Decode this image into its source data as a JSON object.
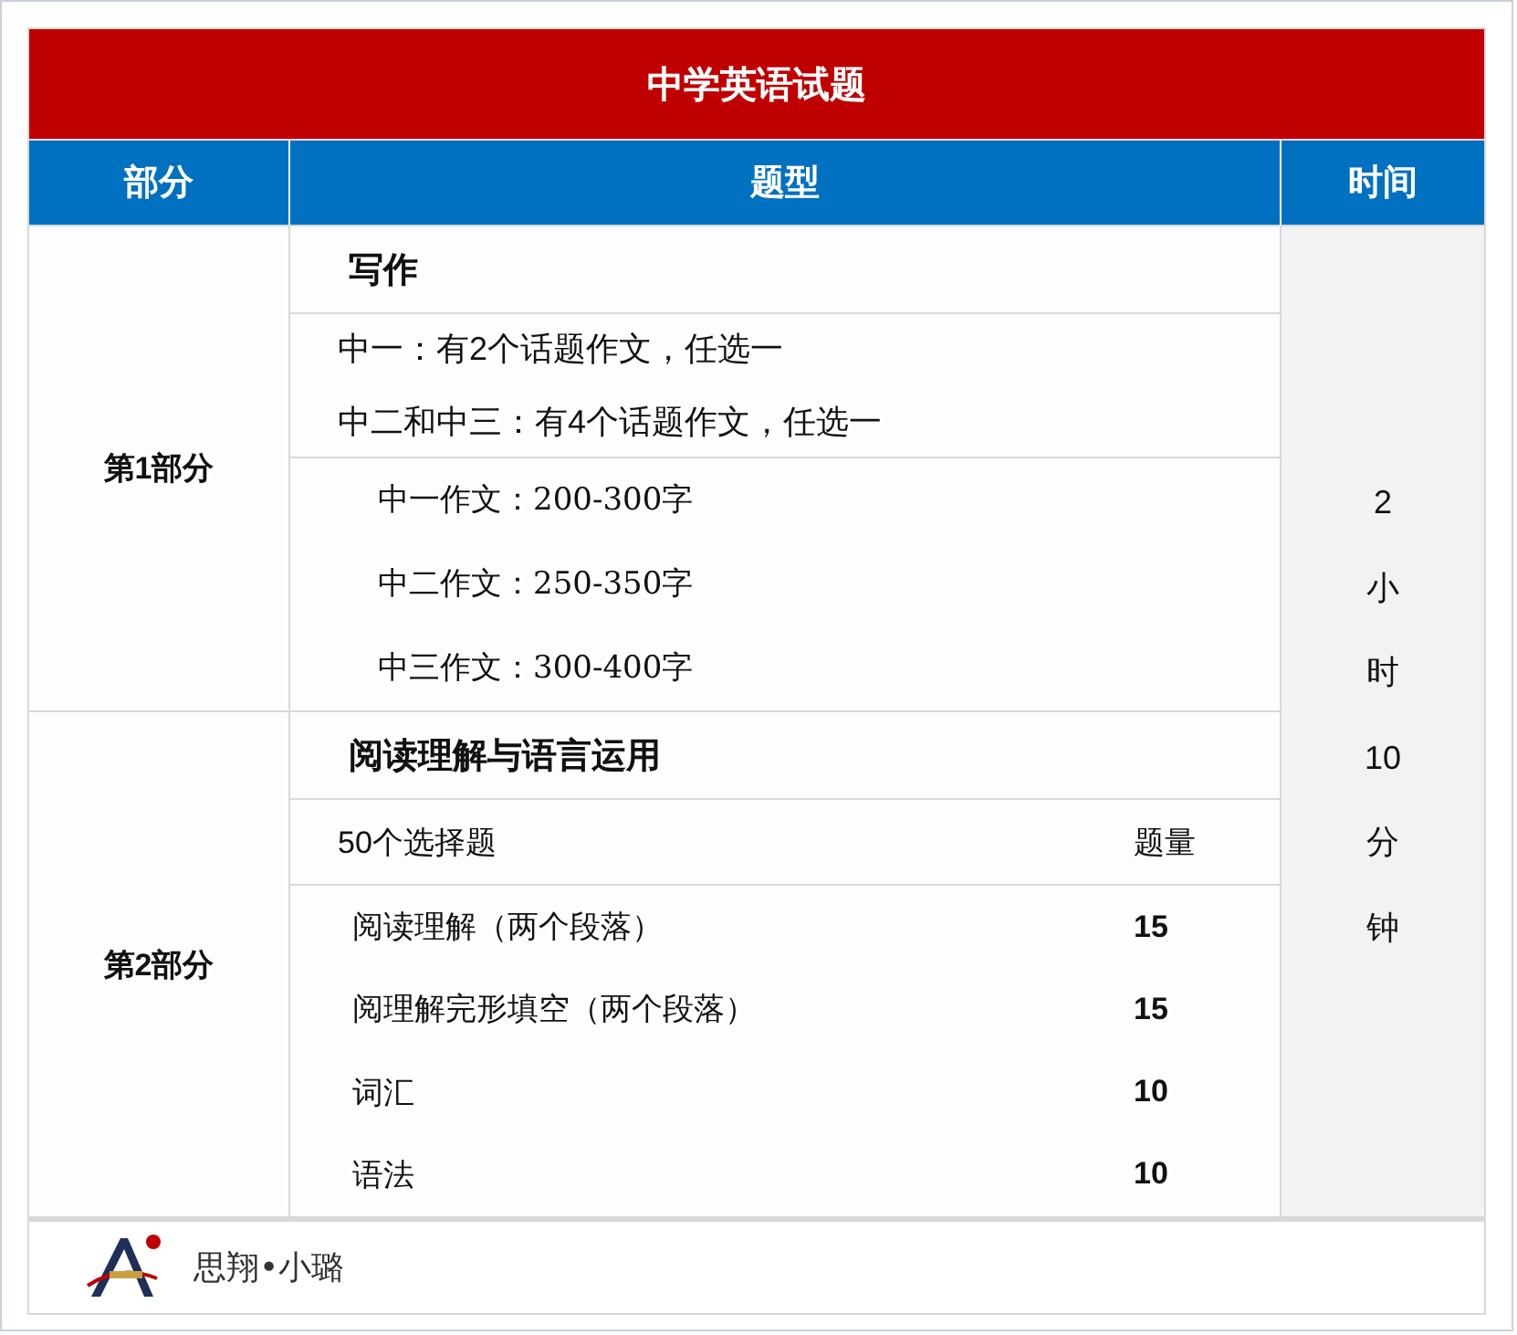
{
  "title": "中学英语试题",
  "columns": [
    "部分",
    "题型",
    "时间"
  ],
  "time_lines": [
    "2",
    "小",
    "时",
    "10",
    "分",
    "钟"
  ],
  "sections": [
    {
      "part": "第1部分",
      "heading": "写作",
      "blocks": [
        {
          "kind": "plain",
          "lines": [
            "中一：有2个话题作文，任选一",
            "中二和中三：有4个话题作文，任选一"
          ]
        },
        {
          "kind": "indented",
          "lines": [
            "中一作文：200-300字",
            "中二作文：250-350字",
            "中三作文：300-400字"
          ]
        }
      ]
    },
    {
      "part": "第2部分",
      "heading": "阅读理解与语言运用",
      "blocks": [
        {
          "kind": "header",
          "label": "50个选择题",
          "count_label": "题量"
        },
        {
          "kind": "items",
          "items": [
            {
              "label": "阅读理解（两个段落）",
              "count": "15"
            },
            {
              "label": "阅理解完形填空（两个段落）",
              "count": "15"
            },
            {
              "label": "词汇",
              "count": "10"
            },
            {
              "label": "语法",
              "count": "10"
            }
          ]
        }
      ]
    }
  ],
  "footer": {
    "brand": "思翔•小璐"
  }
}
